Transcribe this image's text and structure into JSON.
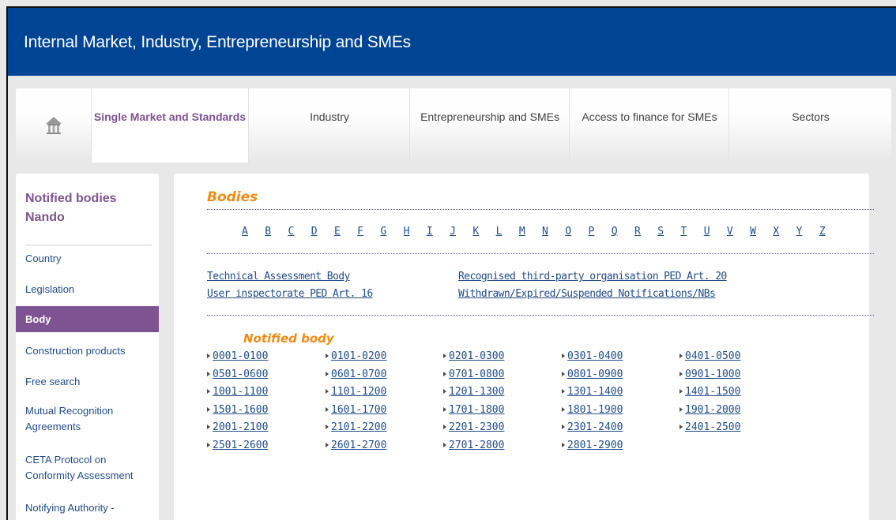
{
  "header": {
    "title": "Internal Market, Industry, Entrepreneurship and SMEs"
  },
  "nav": {
    "home_icon": "home-icon",
    "items": [
      {
        "label": "Single Market and Standards",
        "active": true
      },
      {
        "label": "Industry",
        "active": false
      },
      {
        "label": "Entrepreneurship and SMEs",
        "active": false
      },
      {
        "label": "Access to finance for SMEs",
        "active": false
      },
      {
        "label": "Sectors",
        "active": false
      }
    ]
  },
  "sidebar": {
    "title_line1": "Notified bodies",
    "title_line2": "Nando",
    "items": [
      {
        "label": "Country"
      },
      {
        "label": "Legislation"
      },
      {
        "label": "Body",
        "active": true
      },
      {
        "label": "Construction products"
      },
      {
        "label": "Free search"
      },
      {
        "label": "Mutual Recognition Agreements"
      },
      {
        "label": "CETA Protocol on Conformity Assessment"
      },
      {
        "label": "Notifying Authority -"
      }
    ]
  },
  "main": {
    "title": "Bodies",
    "letters": [
      "A",
      "B",
      "C",
      "D",
      "E",
      "F",
      "G",
      "H",
      "I",
      "J",
      "K",
      "L",
      "M",
      "N",
      "O",
      "P",
      "Q",
      "R",
      "S",
      "T",
      "U",
      "V",
      "W",
      "X",
      "Y",
      "Z"
    ],
    "links": {
      "tab": "Technical Assessment Body",
      "user_insp": "User inspectorate PED Art. 16",
      "rto": "Recognised third-party organisation PED Art. 20",
      "withdrawn": "Withdrawn/Expired/Suspended Notifications/NBs"
    },
    "notified_body_title": "Notified body",
    "ranges": [
      [
        "0001-0100",
        "0101-0200",
        "0201-0300",
        "0301-0400",
        "0401-0500"
      ],
      [
        "0501-0600",
        "0601-0700",
        "0701-0800",
        "0801-0900",
        "0901-1000"
      ],
      [
        "1001-1100",
        "1101-1200",
        "1201-1300",
        "1301-1400",
        "1401-1500"
      ],
      [
        "1501-1600",
        "1601-1700",
        "1701-1800",
        "1801-1900",
        "1901-2000"
      ],
      [
        "2001-2100",
        "2101-2200",
        "2201-2300",
        "2301-2400",
        "2401-2500"
      ],
      [
        "2501-2600",
        "2601-2700",
        "2701-2800",
        "2801-2900"
      ]
    ]
  },
  "colors": {
    "header_bg": "#004494",
    "accent_purple": "#7e5391",
    "accent_orange": "#f28b12",
    "link_blue": "#1f4c8c"
  }
}
